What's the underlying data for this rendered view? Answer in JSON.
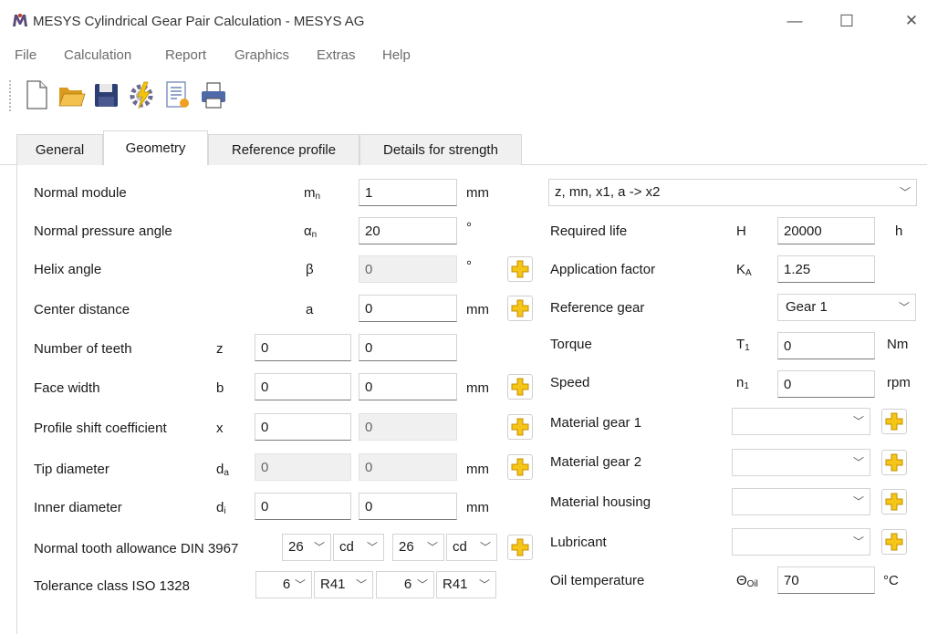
{
  "window": {
    "title": "MESYS Cylindrical Gear Pair Calculation - MESYS AG",
    "minimize": "—",
    "maximize": "☐",
    "close": "✕"
  },
  "menu": [
    "File",
    "Calculation",
    "Report",
    "Graphics",
    "Extras",
    "Help"
  ],
  "tabs": [
    "General",
    "Geometry",
    "Reference profile",
    "Details for strength"
  ],
  "active_tab": "Geometry",
  "left": {
    "normal_module": {
      "label": "Normal module",
      "sym": "m",
      "sub": "n",
      "val": "1",
      "unit": "mm"
    },
    "pressure_angle": {
      "label": "Normal pressure angle",
      "sym": "α",
      "sub": "n",
      "val": "20",
      "unit": "°"
    },
    "helix_angle": {
      "label": "Helix angle",
      "sym": "β",
      "val": "0",
      "unit": "°"
    },
    "center_distance": {
      "label": "Center distance",
      "sym": "a",
      "val": "0",
      "unit": "mm"
    },
    "teeth": {
      "label": "Number of teeth",
      "sym": "z",
      "v1": "0",
      "v2": "0"
    },
    "face_width": {
      "label": "Face width",
      "sym": "b",
      "v1": "0",
      "v2": "0",
      "unit": "mm"
    },
    "profile_shift": {
      "label": "Profile shift coefficient",
      "sym": "x",
      "v1": "0",
      "v2": "0"
    },
    "tip_diameter": {
      "label": "Tip diameter",
      "sym": "d",
      "sub": "a",
      "v1": "0",
      "v2": "0",
      "unit": "mm"
    },
    "inner_diameter": {
      "label": "Inner diameter",
      "sym": "d",
      "sub": "i",
      "v1": "0",
      "v2": "0",
      "unit": "mm"
    },
    "tooth_allowance": {
      "label": "Normal tooth allowance DIN 3967",
      "s1": "26",
      "s2": "cd",
      "s3": "26",
      "s4": "cd"
    },
    "tolerance": {
      "label": "Tolerance class ISO 1328",
      "s1": "6",
      "s2": "R41",
      "s3": "6",
      "s4": "R41"
    }
  },
  "right": {
    "calc_mode": "z, mn, x1, a  -> x2",
    "required_life": {
      "label": "Required life",
      "sym": "H",
      "val": "20000",
      "unit": "h"
    },
    "application_factor": {
      "label": "Application factor",
      "sym": "K",
      "sub": "A",
      "val": "1.25"
    },
    "reference_gear": {
      "label": "Reference gear",
      "val": "Gear 1"
    },
    "torque": {
      "label": "Torque",
      "sym": "T",
      "sub": "1",
      "val": "0",
      "unit": "Nm"
    },
    "speed": {
      "label": "Speed",
      "sym": "n",
      "sub": "1",
      "val": "0",
      "unit": "rpm"
    },
    "material_gear1": {
      "label": "Material gear 1",
      "val": ""
    },
    "material_gear2": {
      "label": "Material gear 2",
      "val": ""
    },
    "material_housing": {
      "label": "Material housing",
      "val": ""
    },
    "lubricant": {
      "label": "Lubricant",
      "val": ""
    },
    "oil_temperature": {
      "label": "Oil temperature",
      "sym": "Θ",
      "sub": "Oil",
      "val": "70",
      "unit": "°C"
    }
  },
  "icons": {
    "chevron": "chevron-down-icon",
    "plus_color": "#f2b705"
  }
}
